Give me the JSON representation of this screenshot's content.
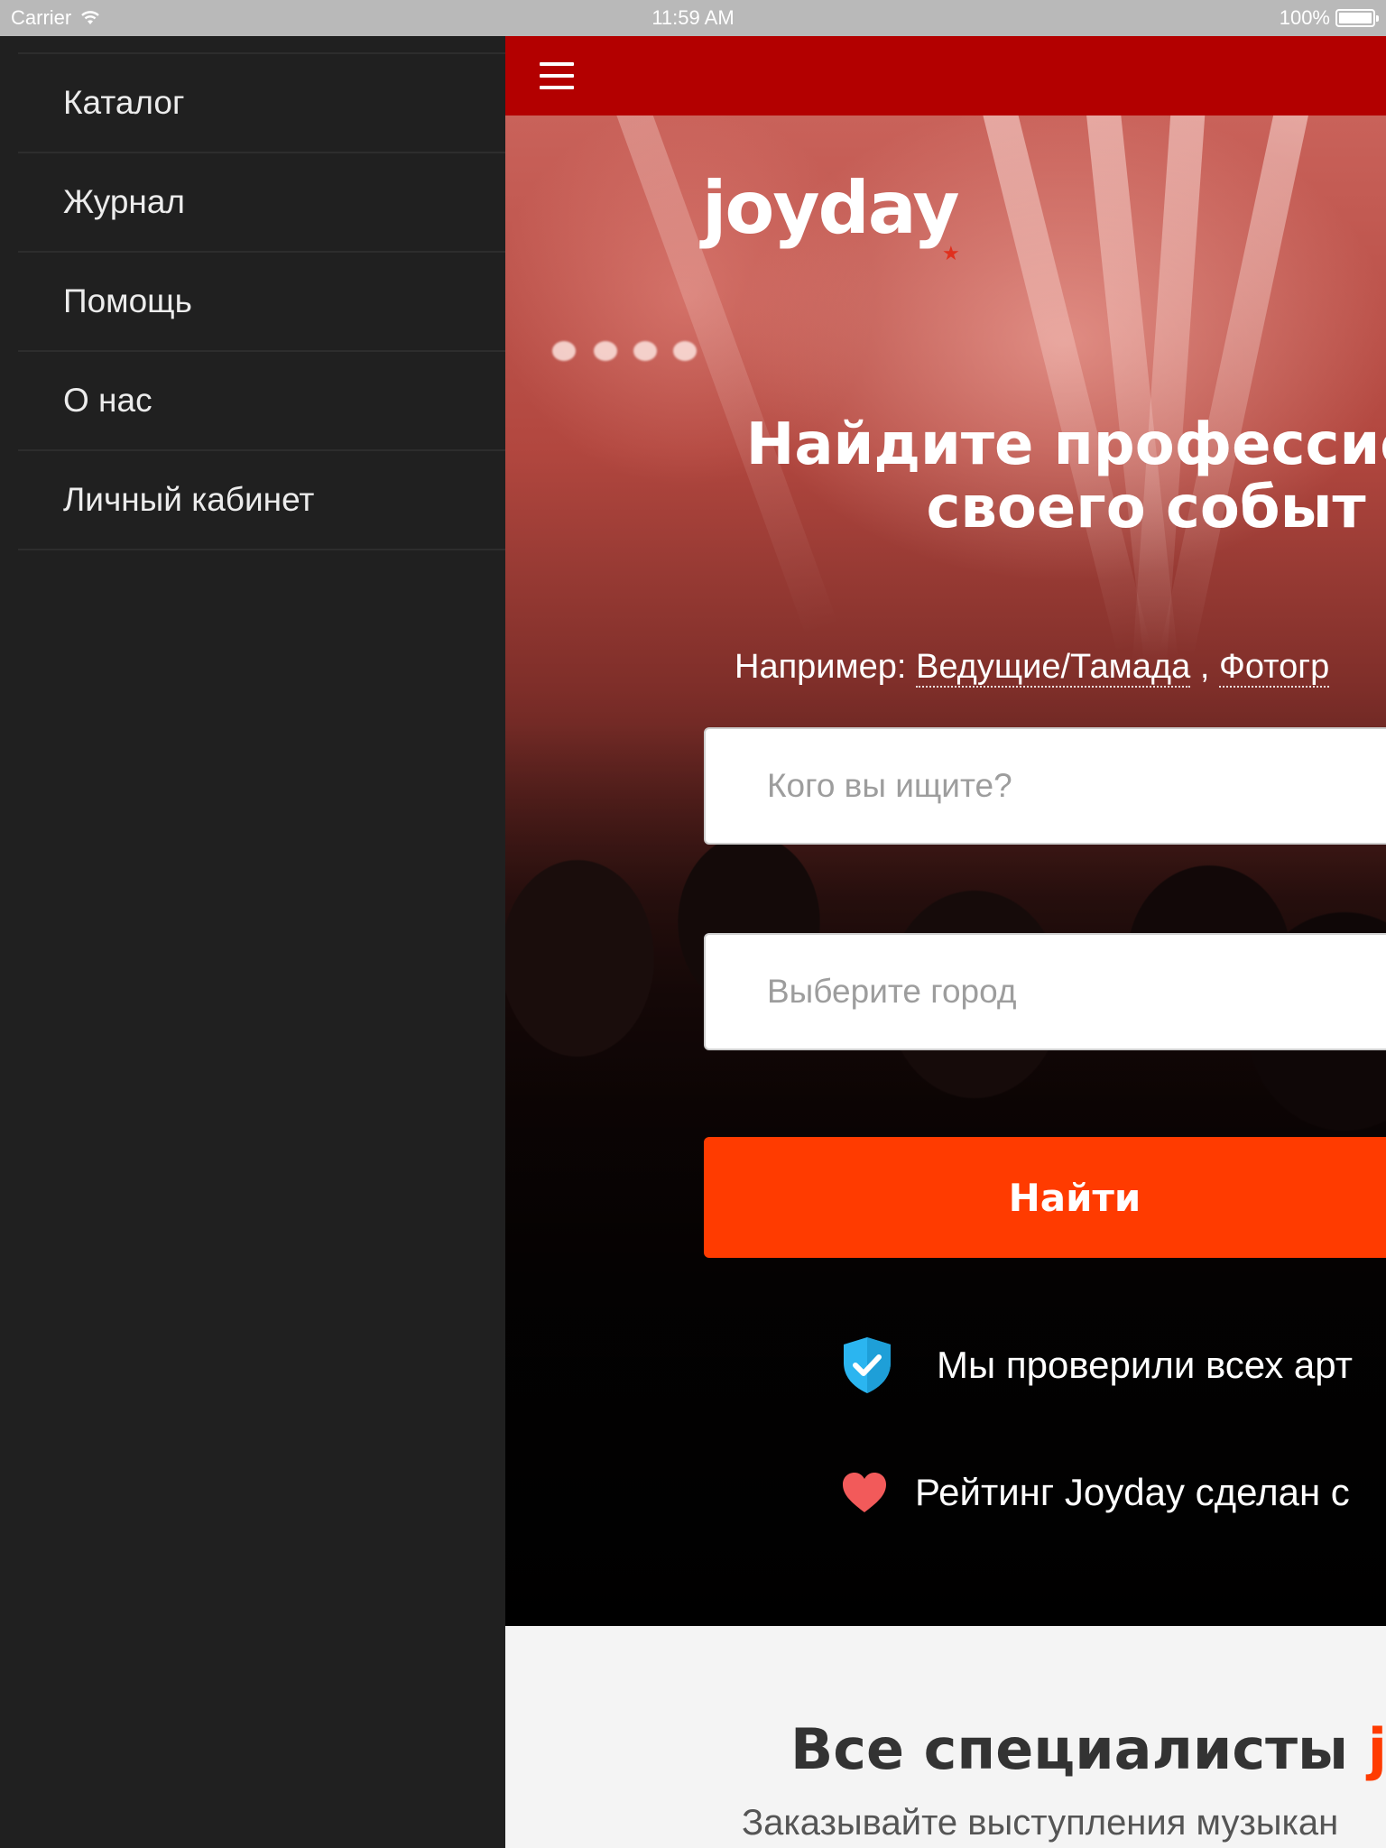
{
  "status_bar": {
    "carrier": "Carrier",
    "time": "11:59 AM",
    "battery": "100%"
  },
  "menu": {
    "items": [
      {
        "label": "Каталог"
      },
      {
        "label": "Журнал"
      },
      {
        "label": "Помощь"
      },
      {
        "label": "О нас"
      },
      {
        "label": "Личный кабинет"
      }
    ]
  },
  "hero": {
    "logo": "joyday",
    "headline_line1": "Найдите профессио",
    "headline_line2": "своего событ",
    "example_prefix": "Например:",
    "example_link1": "Ведущие/Тамада",
    "example_separator": ",",
    "example_link2": "Фотогр",
    "search_placeholder": "Кого вы ищите?",
    "city_placeholder": "Выберите город",
    "find_button": "Найти",
    "feature_verified": "Мы проверили всех арт",
    "feature_rating": "Рейтинг Joyday сделан с"
  },
  "lower": {
    "title_prefix": "Все специалисты",
    "title_brand": "joy",
    "subtitle": "Заказывайте выступления музыкан"
  },
  "colors": {
    "topbar": "#b30000",
    "accent": "#ff3b00",
    "menu_bg": "#202020",
    "shield": "#2bb5f0",
    "heart": "#f25a5a"
  }
}
